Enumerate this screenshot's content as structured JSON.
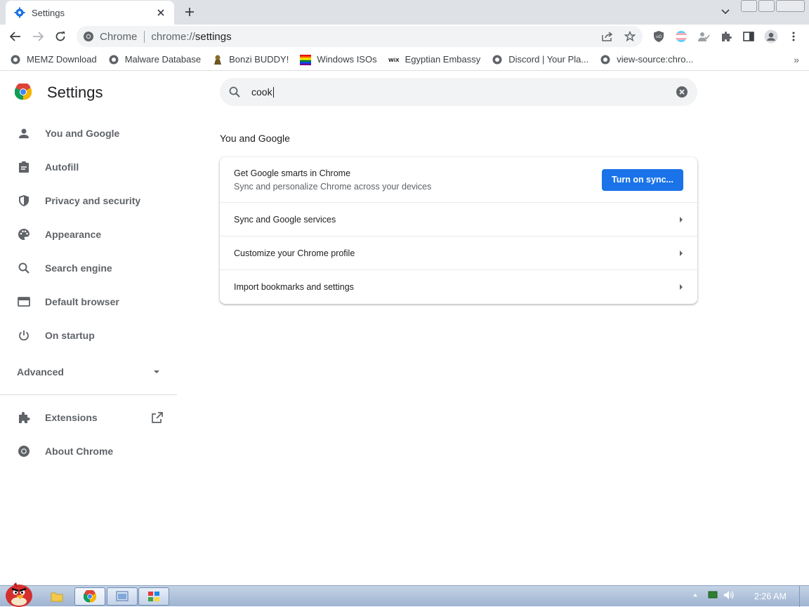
{
  "tab": {
    "title": "Settings",
    "close_label": "×"
  },
  "omnibox": {
    "site_chip": "Chrome",
    "url_scheme": "chrome://",
    "url_path": "settings"
  },
  "bookmarks": [
    {
      "label": "MEMZ Download",
      "icon": "globe-icon"
    },
    {
      "label": "Malware Database",
      "icon": "globe-icon"
    },
    {
      "label": "Bonzi BUDDY!",
      "icon": "bonzi-icon"
    },
    {
      "label": "Windows ISOs",
      "icon": "rainbow-flag-icon"
    },
    {
      "label": "Egyptian Embassy",
      "icon": "wix-icon"
    },
    {
      "label": "Discord | Your Pla...",
      "icon": "globe-icon"
    },
    {
      "label": "view-source:chro...",
      "icon": "globe-icon"
    }
  ],
  "bookmarks_more": "»",
  "settings": {
    "title": "Settings",
    "search_value": "cook",
    "nav": [
      {
        "label": "You and Google",
        "icon": "person-icon"
      },
      {
        "label": "Autofill",
        "icon": "clipboard-icon"
      },
      {
        "label": "Privacy and security",
        "icon": "shield-icon"
      },
      {
        "label": "Appearance",
        "icon": "palette-icon"
      },
      {
        "label": "Search engine",
        "icon": "search-icon"
      },
      {
        "label": "Default browser",
        "icon": "browser-icon"
      },
      {
        "label": "On startup",
        "icon": "power-icon"
      }
    ],
    "advanced_label": "Advanced",
    "extensions_label": "Extensions",
    "about_label": "About Chrome",
    "section_title": "You and Google",
    "sync": {
      "main": "Get Google smarts in Chrome",
      "sub": "Sync and personalize Chrome across your devices",
      "button": "Turn on sync..."
    },
    "rows": [
      {
        "label": "Sync and Google services"
      },
      {
        "label": "Customize your Chrome profile"
      },
      {
        "label": "Import bookmarks and settings"
      }
    ]
  },
  "taskbar": {
    "clock": "2:26 AM"
  },
  "colors": {
    "accent": "#1a73e8",
    "tabstrip": "#dee1e6",
    "omnibox": "#f1f3f4"
  }
}
